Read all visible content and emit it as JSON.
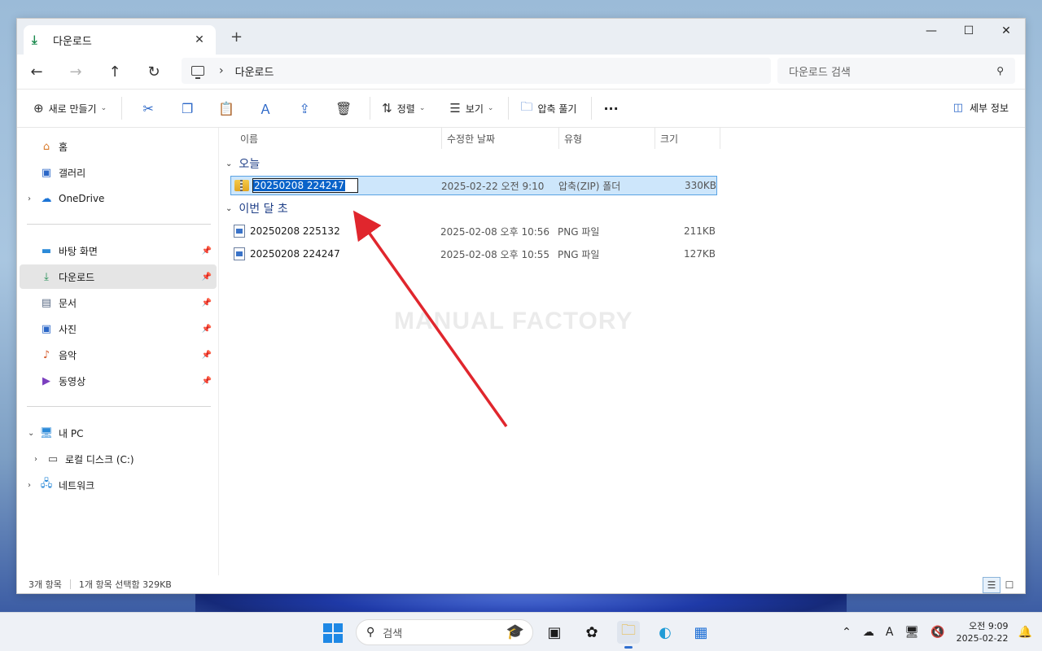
{
  "window": {
    "tab_title": "다운로드",
    "new_tab": "+",
    "controls": [
      "—",
      "☐",
      "✕"
    ]
  },
  "nav": {
    "back": "←",
    "forward": "→",
    "up": "↑",
    "refresh": "↻",
    "breadcrumb_sep": "›",
    "breadcrumb": "다운로드",
    "search_placeholder": "다운로드 검색"
  },
  "toolbar": {
    "new_label": "새로 만들기",
    "sort_label": "정렬",
    "view_label": "보기",
    "extract_label": "압축 풀기",
    "more_label": "···",
    "details_label": "세부 정보"
  },
  "sidebar": {
    "home": "홈",
    "gallery": "갤러리",
    "onedrive": "OneDrive",
    "desktop": "바탕 화면",
    "downloads": "다운로드",
    "documents": "문서",
    "pictures": "사진",
    "music": "음악",
    "videos": "동영상",
    "this_pc": "내 PC",
    "local_disk": "로컬 디스크 (C:)",
    "network": "네트워크"
  },
  "columns": {
    "name": "이름",
    "modified": "수정한 날짜",
    "type": "유형",
    "size": "크기"
  },
  "groups": {
    "today": "오늘",
    "early_this_month": "이번 달 초"
  },
  "files": {
    "zip": {
      "name": "20250208 224247",
      "modified": "2025-02-22 오전 9:10",
      "type": "압축(ZIP) 폴더",
      "size": "330KB"
    },
    "png1": {
      "name": "20250208 225132",
      "modified": "2025-02-08 오후 10:56",
      "type": "PNG 파일",
      "size": "211KB"
    },
    "png2": {
      "name": "20250208 224247",
      "modified": "2025-02-08 오후 10:55",
      "type": "PNG 파일",
      "size": "127KB"
    }
  },
  "watermark": "MANUAL FACTORY",
  "status": {
    "count": "3개 항목",
    "selected": "1개 항목 선택함 329KB"
  },
  "taskbar": {
    "search_placeholder": "검색",
    "time": "오전 9:09",
    "date": "2025-02-22"
  },
  "colors": {
    "accent": "#0a63c9",
    "selection": "#cde6fb",
    "arrow": "#e0262d",
    "group_header": "#1f3f87"
  }
}
